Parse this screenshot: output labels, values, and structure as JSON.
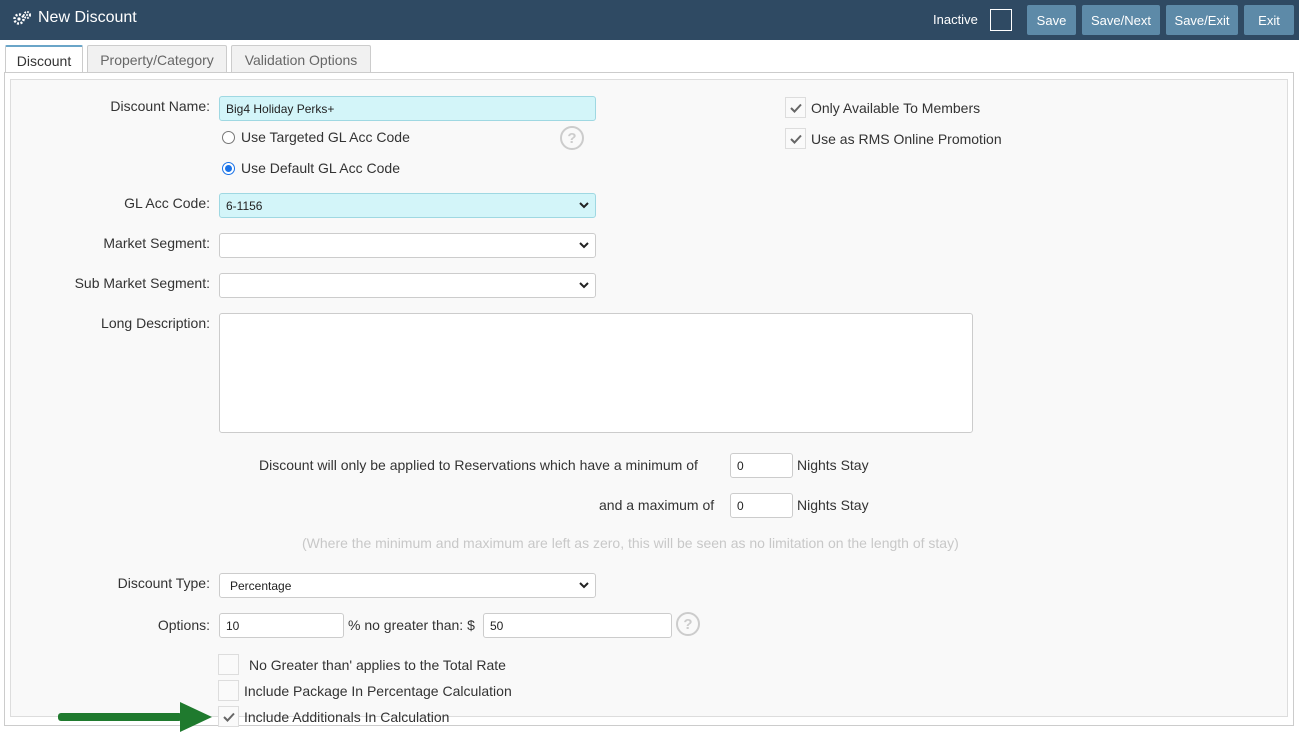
{
  "header": {
    "title": "New Discount",
    "icon": "gears-icon",
    "inactive_label": "Inactive",
    "inactive_checked": false,
    "buttons": {
      "save": "Save",
      "save_next": "Save/Next",
      "save_exit": "Save/Exit",
      "exit": "Exit"
    }
  },
  "tabs": [
    {
      "label": "Discount",
      "active": true
    },
    {
      "label": "Property/Category",
      "active": false
    },
    {
      "label": "Validation Options",
      "active": false
    }
  ],
  "form": {
    "discount_name_label": "Discount Name:",
    "discount_name_value": "Big4 Holiday Perks+",
    "gl_option_targeted": "Use Targeted GL Acc Code",
    "gl_option_default": "Use Default GL Acc Code",
    "gl_selected": "default",
    "gl_acc_code_label": "GL Acc Code:",
    "gl_acc_code_value": "6-1156",
    "market_segment_label": "Market Segment:",
    "market_segment_value": "",
    "sub_market_segment_label": "Sub Market Segment:",
    "sub_market_segment_value": "",
    "long_description_label": "Long Description:",
    "long_description_value": "",
    "only_members_label": "Only Available To Members",
    "only_members_checked": true,
    "online_promo_label": "Use as RMS Online Promotion",
    "online_promo_checked": true,
    "min_nights_text": "Discount will only be applied to Reservations which have a minimum of",
    "min_nights_value": "0",
    "nights_stay_label": "Nights Stay",
    "max_nights_text": "and a maximum of",
    "max_nights_value": "0",
    "nights_hint": "(Where the minimum and maximum are left as zero, this will be seen as no limitation on the length of stay)",
    "discount_type_label": "Discount Type:",
    "discount_type_value": "Percentage",
    "options_label": "Options:",
    "options_percent_value": "10",
    "options_mid_text": "% no greater than: $",
    "options_max_value": "50",
    "no_greater_total_label": "No Greater than' applies to the Total Rate",
    "no_greater_total_checked": false,
    "include_package_label": "Include Package In Percentage Calculation",
    "include_package_checked": false,
    "include_additionals_label": "Include Additionals In Calculation",
    "include_additionals_checked": true
  },
  "colors": {
    "header_bg": "#2f4a63",
    "button_bg": "#5d8aa8",
    "highlight_input": "#d3f5f9",
    "arrow": "#1f7a2e"
  }
}
